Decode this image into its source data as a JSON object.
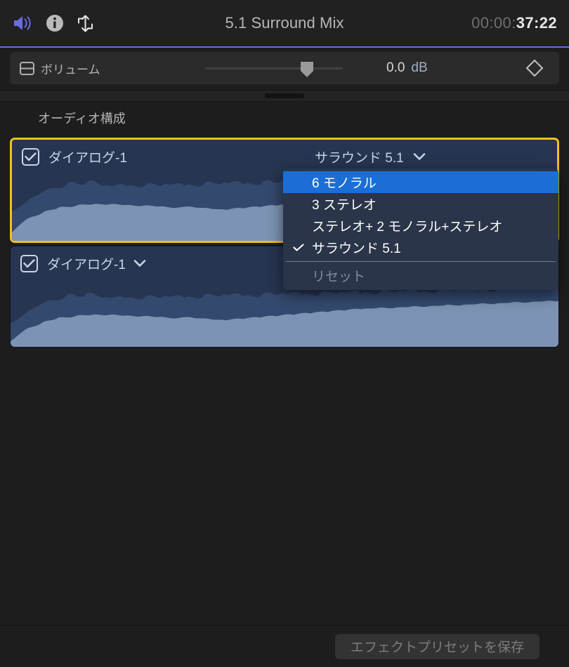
{
  "window": {
    "title": "5.1 Surround Mix",
    "timecode_dim": "00:00:",
    "timecode_active": "37:22",
    "toolbar_icons": [
      {
        "name": "volume-speaker-icon",
        "color": "#6b6be0"
      },
      {
        "name": "info-icon",
        "color": "#b9b9b9"
      },
      {
        "name": "transform-vertical-arrows-icon",
        "color": "#e8e8e8"
      }
    ],
    "accent_color": "#6b6be0"
  },
  "volume_row": {
    "collapse_icon": "disclosure-box-icon",
    "label": "ボリューム",
    "slider": {
      "name": "volume-slider",
      "value_percent": 68
    },
    "value": "0.0",
    "unit": "dB",
    "keyframe_icon": "keyframe-diamond-icon"
  },
  "divider": {
    "handle": "panel-resize-handle"
  },
  "audio_config": {
    "section_title": "オーディオ構成",
    "tracks": [
      {
        "checked": true,
        "name": "ダイアログ-1",
        "has_chevron": false,
        "config_label": "サラウンド 5.1",
        "config_chevron": "chevron-down-icon",
        "selected": true
      },
      {
        "checked": true,
        "name": "ダイアログ-1",
        "has_chevron": true,
        "config_label": "",
        "config_chevron": "",
        "selected": false
      }
    ]
  },
  "dropdown": {
    "open": true,
    "items": [
      {
        "label": "6 モノラル",
        "checked": false,
        "highlighted": true,
        "disabled": false
      },
      {
        "label": "3 ステレオ",
        "checked": false,
        "highlighted": false,
        "disabled": false
      },
      {
        "label": "ステレオ+ 2 モノラル+ステレオ",
        "checked": false,
        "highlighted": false,
        "disabled": false
      },
      {
        "label": "サラウンド 5.1",
        "checked": true,
        "highlighted": false,
        "disabled": false
      }
    ],
    "reset_label": "リセット",
    "highlight_color": "#1b6ed6"
  },
  "footer": {
    "save_preset_label": "エフェクトプリセットを保存",
    "save_preset_disabled": true
  },
  "colors": {
    "selection_border": "#f0c020",
    "track_bg": "#273551",
    "waveform": "#7d93b3",
    "waveform_peaks": "#33496d"
  }
}
